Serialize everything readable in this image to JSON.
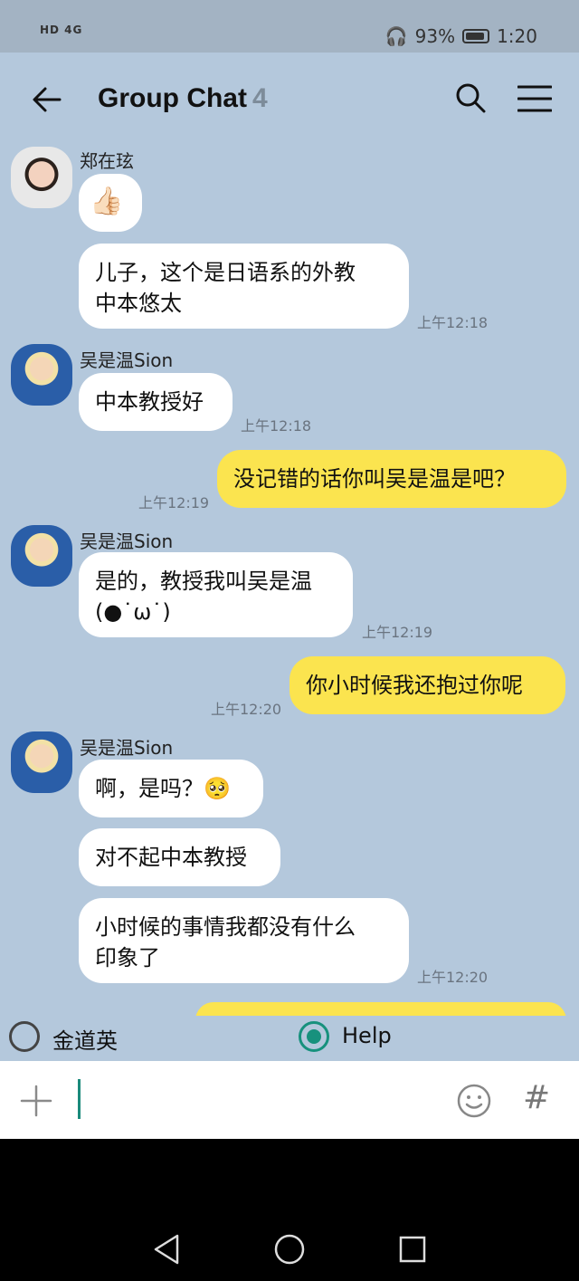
{
  "status_bar": {
    "network": "HD 4G",
    "battery_percent": "93%",
    "time": "1:20"
  },
  "header": {
    "title": "Group Chat",
    "member_count": "4"
  },
  "messages": [
    {
      "sender": "郑在玹",
      "text": "👍🏻",
      "time": ""
    },
    {
      "sender": "郑在玹",
      "text": "儿子，这个是日语系的外教\n中本悠太",
      "time": "上午12:18"
    },
    {
      "sender": "吴是温Sion",
      "text": "中本教授好",
      "time": "上午12:18"
    },
    {
      "sender": "me",
      "text": "没记错的话你叫吴是温是吧？",
      "time": "上午12:19"
    },
    {
      "sender": "吴是温Sion",
      "text": "是的，教授我叫吴是温\n(●˙ω˙)",
      "time": "上午12:19"
    },
    {
      "sender": "me",
      "text": "你小时候我还抱过你呢",
      "time": "上午12:20"
    },
    {
      "sender": "吴是温Sion",
      "text": "啊，是吗？🥺",
      "time": ""
    },
    {
      "sender": "吴是温Sion",
      "text": "对不起中本教授",
      "time": ""
    },
    {
      "sender": "吴是温Sion",
      "text": "小时候的事情我都没有什么\n印象了",
      "time": "上午12:20"
    }
  ],
  "options": {
    "option1": "金道英",
    "option2": "Help",
    "selected": "Help"
  },
  "input_bar": {
    "text": ""
  },
  "colors": {
    "chat_background": "#b4c8dc",
    "my_bubble": "#fbe44f",
    "their_bubble": "#ffffff",
    "accent": "#17917d"
  },
  "icons": {
    "back": "arrow-left-icon",
    "search": "search-icon",
    "menu": "hamburger-menu-icon",
    "plus": "plus-icon",
    "emoji": "smiley-icon",
    "hash": "hash-icon"
  }
}
